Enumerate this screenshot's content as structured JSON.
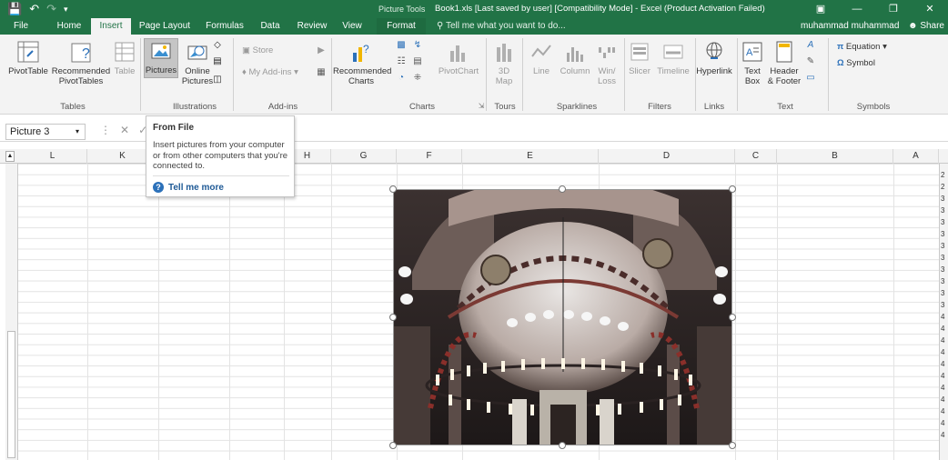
{
  "titlebar": {
    "context_tab_group": "Picture Tools",
    "document_title": "Book1.xls [Last saved by user]  [Compatibility Mode] - Excel (Product Activation Failed)",
    "colors": {
      "excel_green": "#217346"
    }
  },
  "tabs": [
    {
      "label": "File"
    },
    {
      "label": "Home"
    },
    {
      "label": "Insert",
      "active": true
    },
    {
      "label": "Page Layout"
    },
    {
      "label": "Formulas"
    },
    {
      "label": "Data"
    },
    {
      "label": "Review"
    },
    {
      "label": "View"
    },
    {
      "label": "Format"
    }
  ],
  "tell_me": "Tell me what you want to do...",
  "user_name": "muhammad muhammad",
  "share_label": "Share",
  "ribbon": {
    "pivottable": "PivotTable",
    "recommended_pivottables_1": "Recommended",
    "recommended_pivottables_2": "PivotTables",
    "table": "Table",
    "group_tables": "Tables",
    "pictures": "Pictures",
    "online_pictures_1": "Online",
    "online_pictures_2": "Pictures",
    "group_illustrations": "Illustrations",
    "store": "Store",
    "my_addins": "My Add-ins",
    "group_addins": "Add-ins",
    "recommended_charts_1": "Recommended",
    "recommended_charts_2": "Charts",
    "pivotchart": "PivotChart",
    "group_charts": "Charts",
    "map_1": "3D",
    "map_2": "Map",
    "group_tours": "Tours",
    "line": "Line",
    "column": "Column",
    "winloss_1": "Win/",
    "winloss_2": "Loss",
    "group_sparklines": "Sparklines",
    "slicer": "Slicer",
    "timeline": "Timeline",
    "group_filters": "Filters",
    "hyperlink": "Hyperlink",
    "group_links": "Links",
    "textbox_1": "Text",
    "textbox_2": "Box",
    "header_footer_1": "Header",
    "header_footer_2": "& Footer",
    "group_text": "Text",
    "equation": "Equation",
    "symbol": "Symbol",
    "group_symbols": "Symbols"
  },
  "formula_bar": {
    "name_box": "Picture 3"
  },
  "columns": [
    "L",
    "K",
    "J",
    "I",
    "H",
    "G",
    "F",
    "E",
    "D",
    "C",
    "B",
    "A"
  ],
  "row_numbers": [
    "2",
    "2",
    "3",
    "3",
    "3",
    "3",
    "3",
    "3",
    "3",
    "3",
    "3",
    "3",
    "4",
    "4",
    "4",
    "4",
    "4",
    "4",
    "4",
    "4",
    "4",
    "4",
    "4"
  ],
  "tooltip": {
    "title": "From File",
    "body": "Insert pictures from your computer or from other computers that you're connected to.",
    "more": "Tell me more"
  },
  "picture": {
    "subject": "mosque-interior-photo"
  }
}
